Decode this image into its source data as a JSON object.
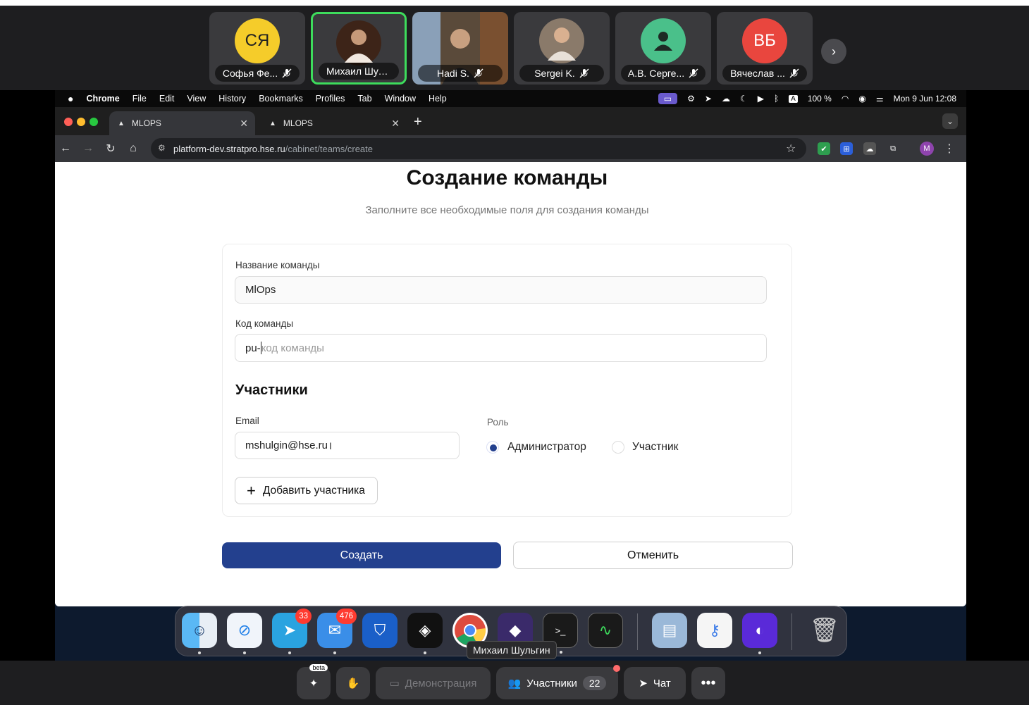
{
  "conference": {
    "participants": [
      {
        "initials": "СЯ",
        "name": "Софья Фе...",
        "color": "#f5cc2a"
      },
      {
        "initials": "",
        "name": "Михаил Шуль...",
        "color": "#5a3a2a"
      },
      {
        "initials": "",
        "name": "Hadi S.",
        "color": "#6b5a44"
      },
      {
        "initials": "",
        "name": "Sergei K.",
        "color": "#8a7a6a"
      },
      {
        "initials": "",
        "name": "А.В. Серге...",
        "color": "#4ac08a"
      },
      {
        "initials": "ВБ",
        "name": "Вячеслав ...",
        "color": "#e9463e"
      }
    ],
    "controls": {
      "demo_label": "Демонстрация",
      "participants_label": "Участники",
      "participants_count": "22",
      "chat_label": "Чат",
      "beta_label": "beta"
    }
  },
  "menubar": {
    "app": "Chrome",
    "items": [
      "File",
      "Edit",
      "View",
      "History",
      "Bookmarks",
      "Profiles",
      "Tab",
      "Window",
      "Help"
    ],
    "battery": "100 %",
    "datetime": "Mon 9 Jun  12:08",
    "input_source": "A"
  },
  "browser": {
    "tabs": [
      {
        "title": "MLOPS"
      },
      {
        "title": "MLOPS"
      }
    ],
    "url_host": "platform-dev.stratpro.hse.ru",
    "url_path": "/cabinet/teams/create",
    "profile_initial": "M"
  },
  "form": {
    "title": "Создание команды",
    "subtitle": "Заполните все необходимые поля для создания команды",
    "team_name_label": "Название команды",
    "team_name_value": "MlOps",
    "team_code_label": "Код команды",
    "team_code_prefix": "pu-",
    "team_code_placeholder": "код команды",
    "members_title": "Участники",
    "email_label": "Email",
    "email_value": "mshulgin@hse.ru",
    "role_label": "Роль",
    "role_admin": "Администратор",
    "role_member": "Участник",
    "add_member": "Добавить участника",
    "create": "Создать",
    "cancel": "Отменить"
  },
  "dock": {
    "telegram_badge": "33",
    "mail_badge": "476",
    "tooltip": "Михаил Шульгин"
  },
  "colors": {
    "primary": "#23408e",
    "active_speaker": "#3ddc5c"
  }
}
